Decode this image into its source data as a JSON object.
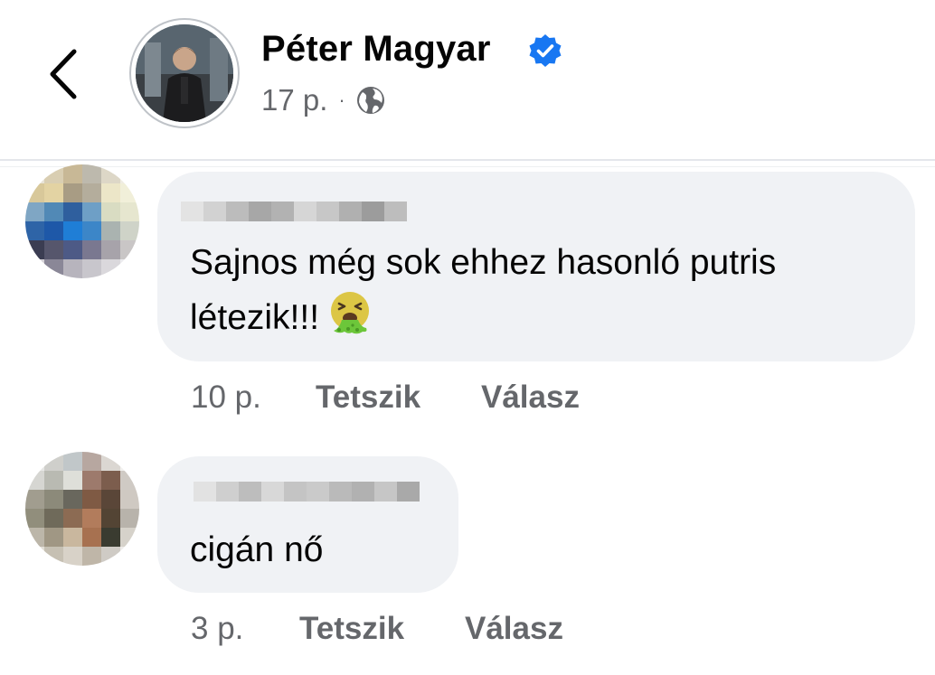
{
  "header": {
    "author_name": "Péter Magyar",
    "time": "17 p.",
    "separator": "·",
    "icons": [
      "chevron-left-icon",
      "verified-badge-icon",
      "globe-icon"
    ],
    "colors": {
      "verified": "#1877f2",
      "meta": "#65676b"
    }
  },
  "comments": [
    {
      "text_line1": "Sajnos még sok ehhez hasonló putris",
      "text_line2": "létezik!!!",
      "emoji": "vomiting-face-emoji",
      "time": "10 p.",
      "like_label": "Tetszik",
      "reply_label": "Válasz"
    },
    {
      "text_line1": "cigán nő",
      "time": "3 p.",
      "like_label": "Tetszik",
      "reply_label": "Válasz"
    }
  ],
  "colors": {
    "bubble": "#f0f2f5",
    "secondary_text": "#65676b"
  }
}
